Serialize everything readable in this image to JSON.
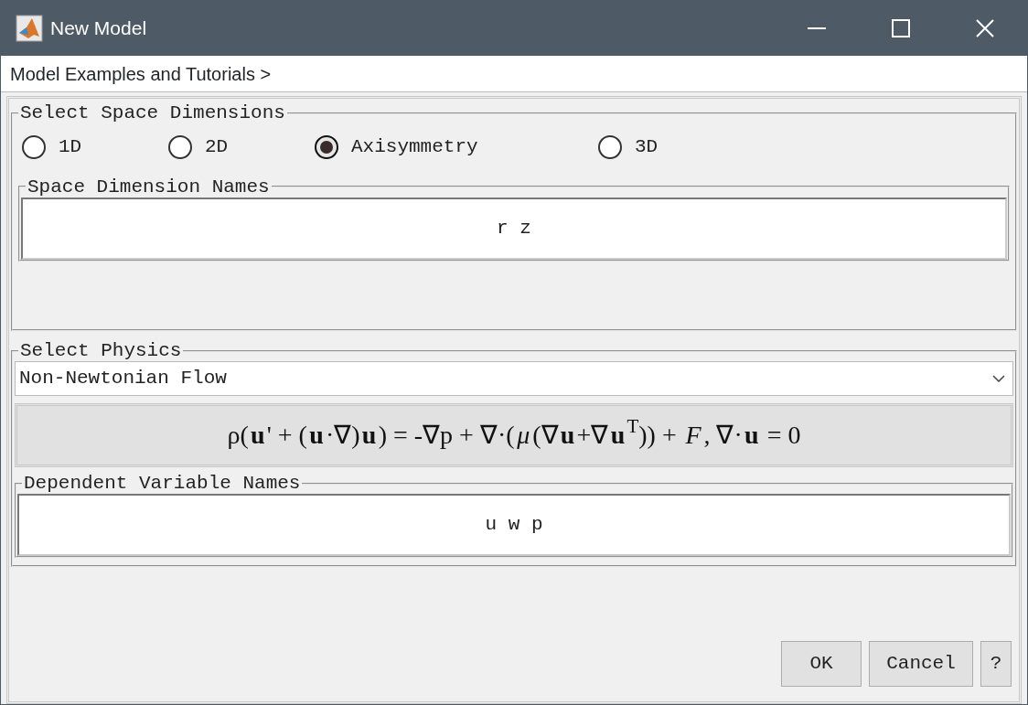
{
  "window": {
    "title": "New Model"
  },
  "menu": {
    "label": "Model Examples and Tutorials >"
  },
  "space_dimensions": {
    "title": "Select Space Dimensions",
    "options": [
      {
        "label": "1D",
        "selected": false
      },
      {
        "label": "2D",
        "selected": false
      },
      {
        "label": "Axisymmetry",
        "selected": true
      },
      {
        "label": "3D",
        "selected": false
      }
    ],
    "names_title": "Space Dimension Names",
    "names_value": "r z"
  },
  "physics": {
    "title": "Select Physics",
    "selection": "Non-Newtonian Flow",
    "equation": "ρ(**u**' + (**u**·∇)**u**) = -∇p + ∇·(*μ*(∇**u**+∇**u**$^{T}$)) + *F*, ∇·**u** = 0",
    "variables_title": "Dependent Variable Names",
    "variables_value": "u w p"
  },
  "buttons": [
    "OK",
    "Cancel",
    "?"
  ]
}
